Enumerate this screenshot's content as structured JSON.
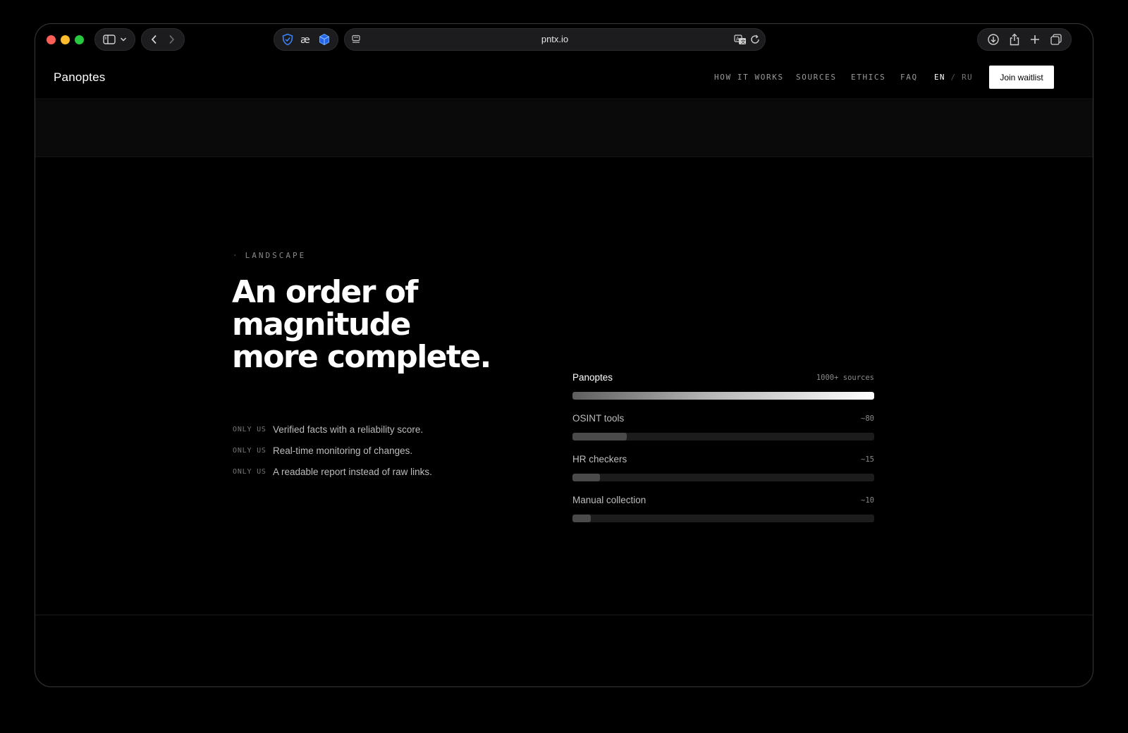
{
  "browser": {
    "url": "pntx.io",
    "icons": [
      "sidebar-icon",
      "chevron-down-icon",
      "back-icon",
      "forward-icon",
      "shield-extension-icon",
      "ae-extension-icon",
      "cube-extension-icon",
      "page-menu-icon",
      "translate-icon",
      "reload-icon",
      "download-icon",
      "share-icon",
      "new-tab-icon",
      "tabs-overview-icon"
    ]
  },
  "header": {
    "logo": "Panoptes",
    "nav": [
      "HOW IT WORKS",
      "SOURCES",
      "ETHICS",
      "FAQ"
    ],
    "lang_active": "EN",
    "lang_separator": "/",
    "lang_other": "RU",
    "cta": "Join waitlist"
  },
  "section": {
    "eyebrow": "LANDSCAPE",
    "headline_line1": "An order of magnitude",
    "headline_line2": "more complete.",
    "features": [
      {
        "tag": "ONLY US",
        "text": "Verified facts with a reliability score."
      },
      {
        "tag": "ONLY US",
        "text": "Real-time monitoring of changes."
      },
      {
        "tag": "ONLY US",
        "text": "A readable report instead of raw links."
      }
    ]
  },
  "comparison": {
    "rows": [
      {
        "name": "Panoptes",
        "count": "1000+ sources",
        "fill_fraction": 1.0
      },
      {
        "name": "OSINT tools",
        "count": "~80",
        "fill_fraction": 0.18
      },
      {
        "name": "HR checkers",
        "count": "~15",
        "fill_fraction": 0.09
      },
      {
        "name": "Manual collection",
        "count": "~10",
        "fill_fraction": 0.06
      }
    ]
  },
  "colors": {
    "background": "#000000",
    "accent_text": "#ffffff",
    "muted_text": "#8a8a8a",
    "bar_track": "#1c1c1c",
    "bar_fill": "#4a4a4a",
    "extension_blue": "#3b82f6"
  }
}
